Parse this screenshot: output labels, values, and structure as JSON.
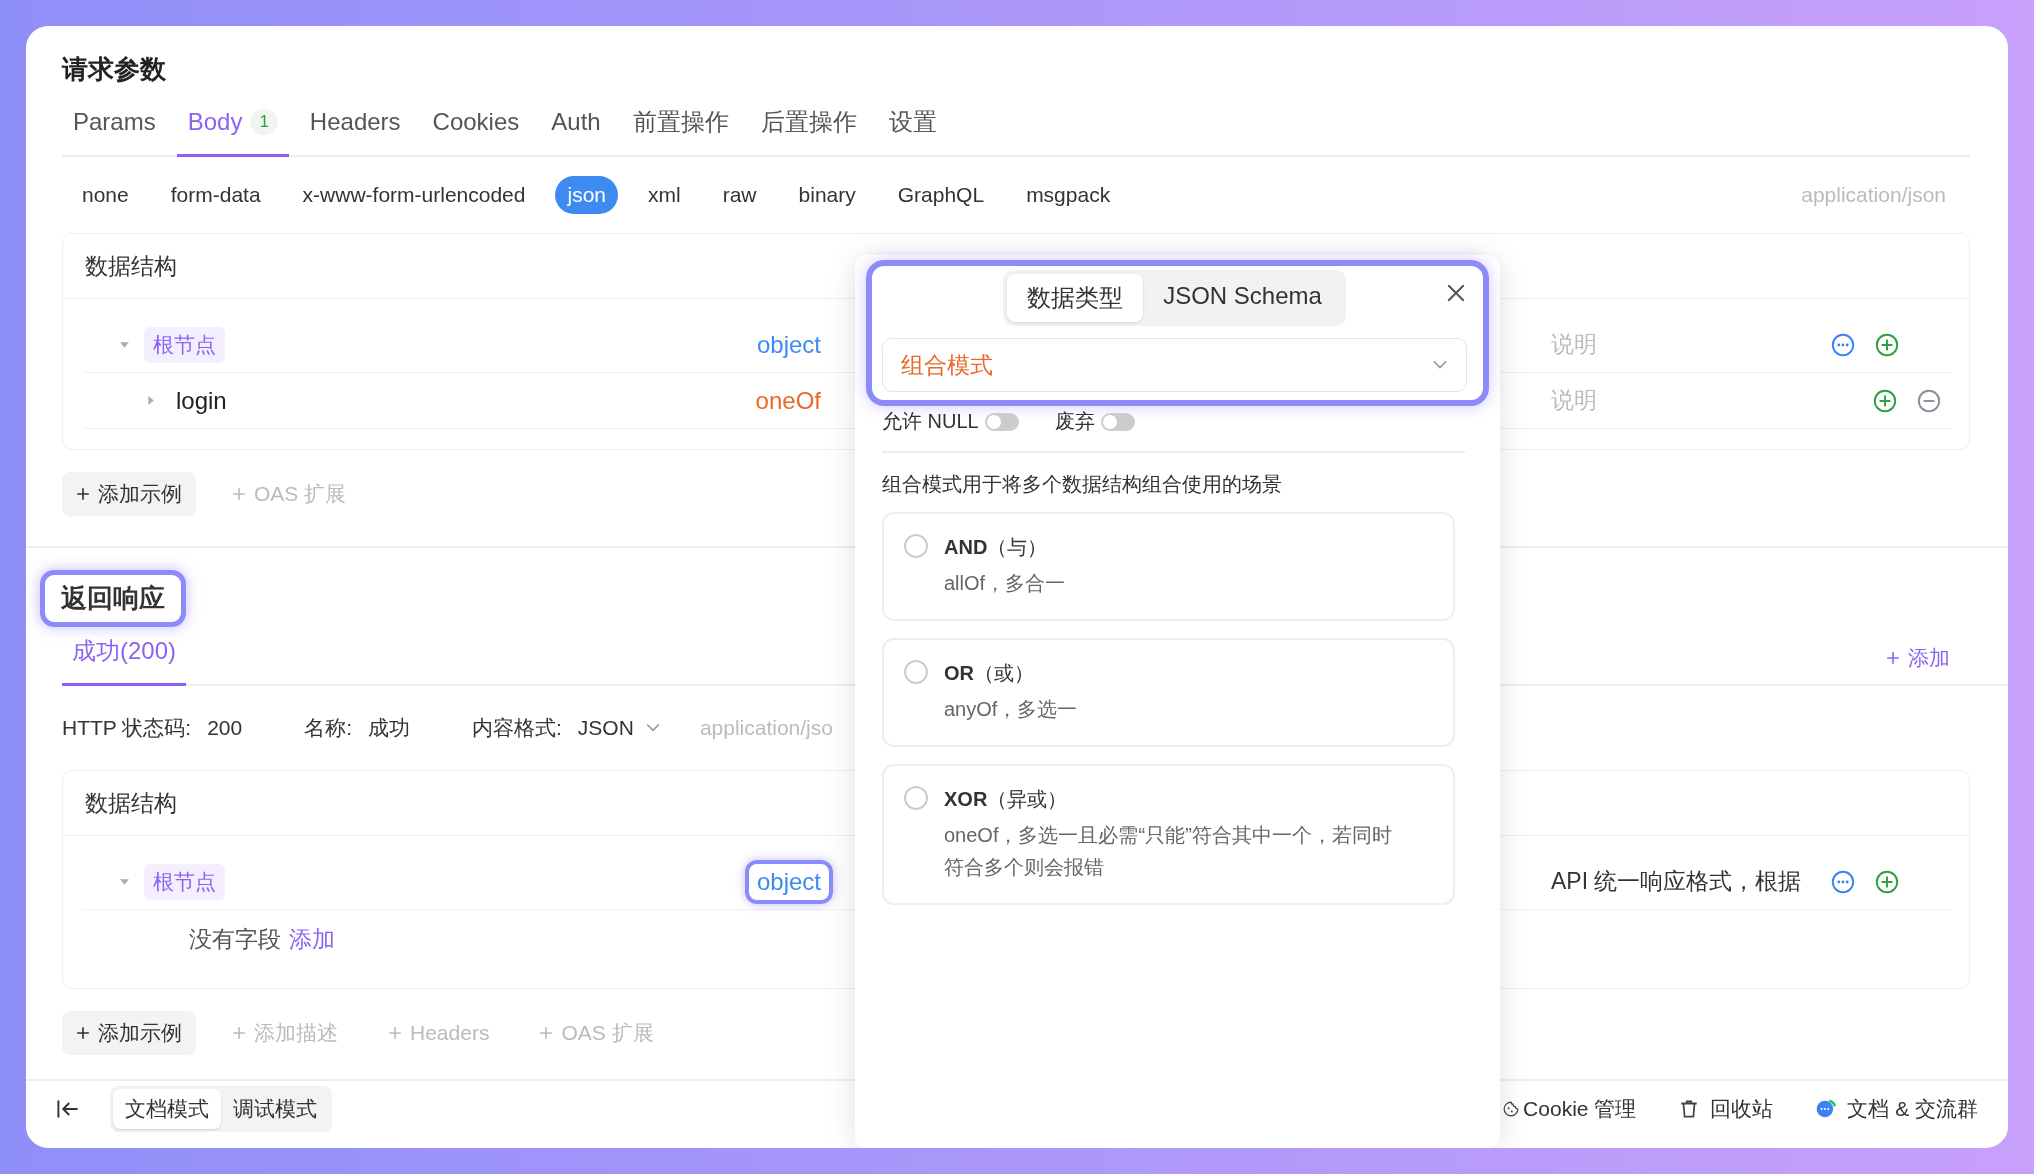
{
  "request": {
    "title": "请求参数",
    "tabs": [
      {
        "label": "Params",
        "selected": false
      },
      {
        "label": "Body",
        "selected": true,
        "badge": "1"
      },
      {
        "label": "Headers",
        "selected": false
      },
      {
        "label": "Cookies",
        "selected": false
      },
      {
        "label": "Auth",
        "selected": false
      },
      {
        "label": "前置操作",
        "selected": false
      },
      {
        "label": "后置操作",
        "selected": false
      },
      {
        "label": "设置",
        "selected": false
      }
    ],
    "body_types": [
      {
        "label": "none",
        "selected": false
      },
      {
        "label": "form-data",
        "selected": false
      },
      {
        "label": "x-www-form-urlencoded",
        "selected": false
      },
      {
        "label": "json",
        "selected": true
      },
      {
        "label": "xml",
        "selected": false
      },
      {
        "label": "raw",
        "selected": false
      },
      {
        "label": "binary",
        "selected": false
      },
      {
        "label": "GraphQL",
        "selected": false
      },
      {
        "label": "msgpack",
        "selected": false
      }
    ],
    "content_type": "application/json",
    "schema": {
      "title": "数据结构",
      "rows": [
        {
          "kind": "root",
          "name": "根节点",
          "expanded": true,
          "type": "object",
          "highlighted": false,
          "description": "说明",
          "description_placeholder": true
        },
        {
          "kind": "field",
          "name": "login",
          "expanded": false,
          "type": "oneOf",
          "highlighted": false,
          "description": "说明",
          "description_placeholder": true
        }
      ]
    },
    "actions": [
      {
        "label": "添加示例",
        "kind": "filled"
      },
      {
        "label": "OAS 扩展",
        "kind": "ghost"
      }
    ]
  },
  "response": {
    "title": "返回响应",
    "highlighted": true,
    "tabs": [
      {
        "label": "成功(200)",
        "selected": true
      }
    ],
    "add_label": "添加",
    "meta": [
      {
        "label": "HTTP 状态码:",
        "value": "200"
      },
      {
        "label": "名称:",
        "value": "成功"
      },
      {
        "label": "内容格式:",
        "value": "JSON",
        "dropdown": true
      }
    ],
    "content_type": "application/jso",
    "schema": {
      "title": "数据结构",
      "rows": [
        {
          "kind": "root",
          "name": "根节点",
          "expanded": true,
          "type": "object",
          "highlighted": true,
          "description": "API 统一响应格式，根据",
          "description_placeholder": false
        }
      ],
      "empty_text": "没有字段",
      "empty_link": "添加"
    },
    "actions": [
      {
        "label": "添加示例",
        "kind": "filled"
      },
      {
        "label": "添加描述",
        "kind": "ghost"
      },
      {
        "label": "Headers",
        "kind": "ghost"
      },
      {
        "label": "OAS 扩展",
        "kind": "ghost"
      }
    ]
  },
  "footer": {
    "modes": [
      {
        "label": "文档模式",
        "selected": true
      },
      {
        "label": "调试模式",
        "selected": false
      }
    ],
    "links": [
      {
        "label": "Cookie 管理"
      },
      {
        "label": "回收站"
      },
      {
        "label": "文档 & 交流群"
      }
    ]
  },
  "popup": {
    "highlighted": true,
    "tabs": [
      {
        "label": "数据类型",
        "selected": true
      },
      {
        "label": "JSON Schema",
        "selected": false
      }
    ],
    "select_value": "组合模式",
    "toggles": [
      {
        "label": "允许 NULL",
        "on": false
      },
      {
        "label": "废弃",
        "on": false
      }
    ],
    "hint": "组合模式用于将多个数据结构组合使用的场景",
    "options": [
      {
        "title": "**AND**（与）",
        "description": "allOf，多合一",
        "selected": false
      },
      {
        "title": "**OR**（或）",
        "description": "anyOf，多选一",
        "selected": false
      },
      {
        "title": "**XOR**（异或）",
        "description": "oneOf，多选一且必需“只能”符合其中一个，若同时符合多个则会报错",
        "selected": false
      }
    ]
  }
}
